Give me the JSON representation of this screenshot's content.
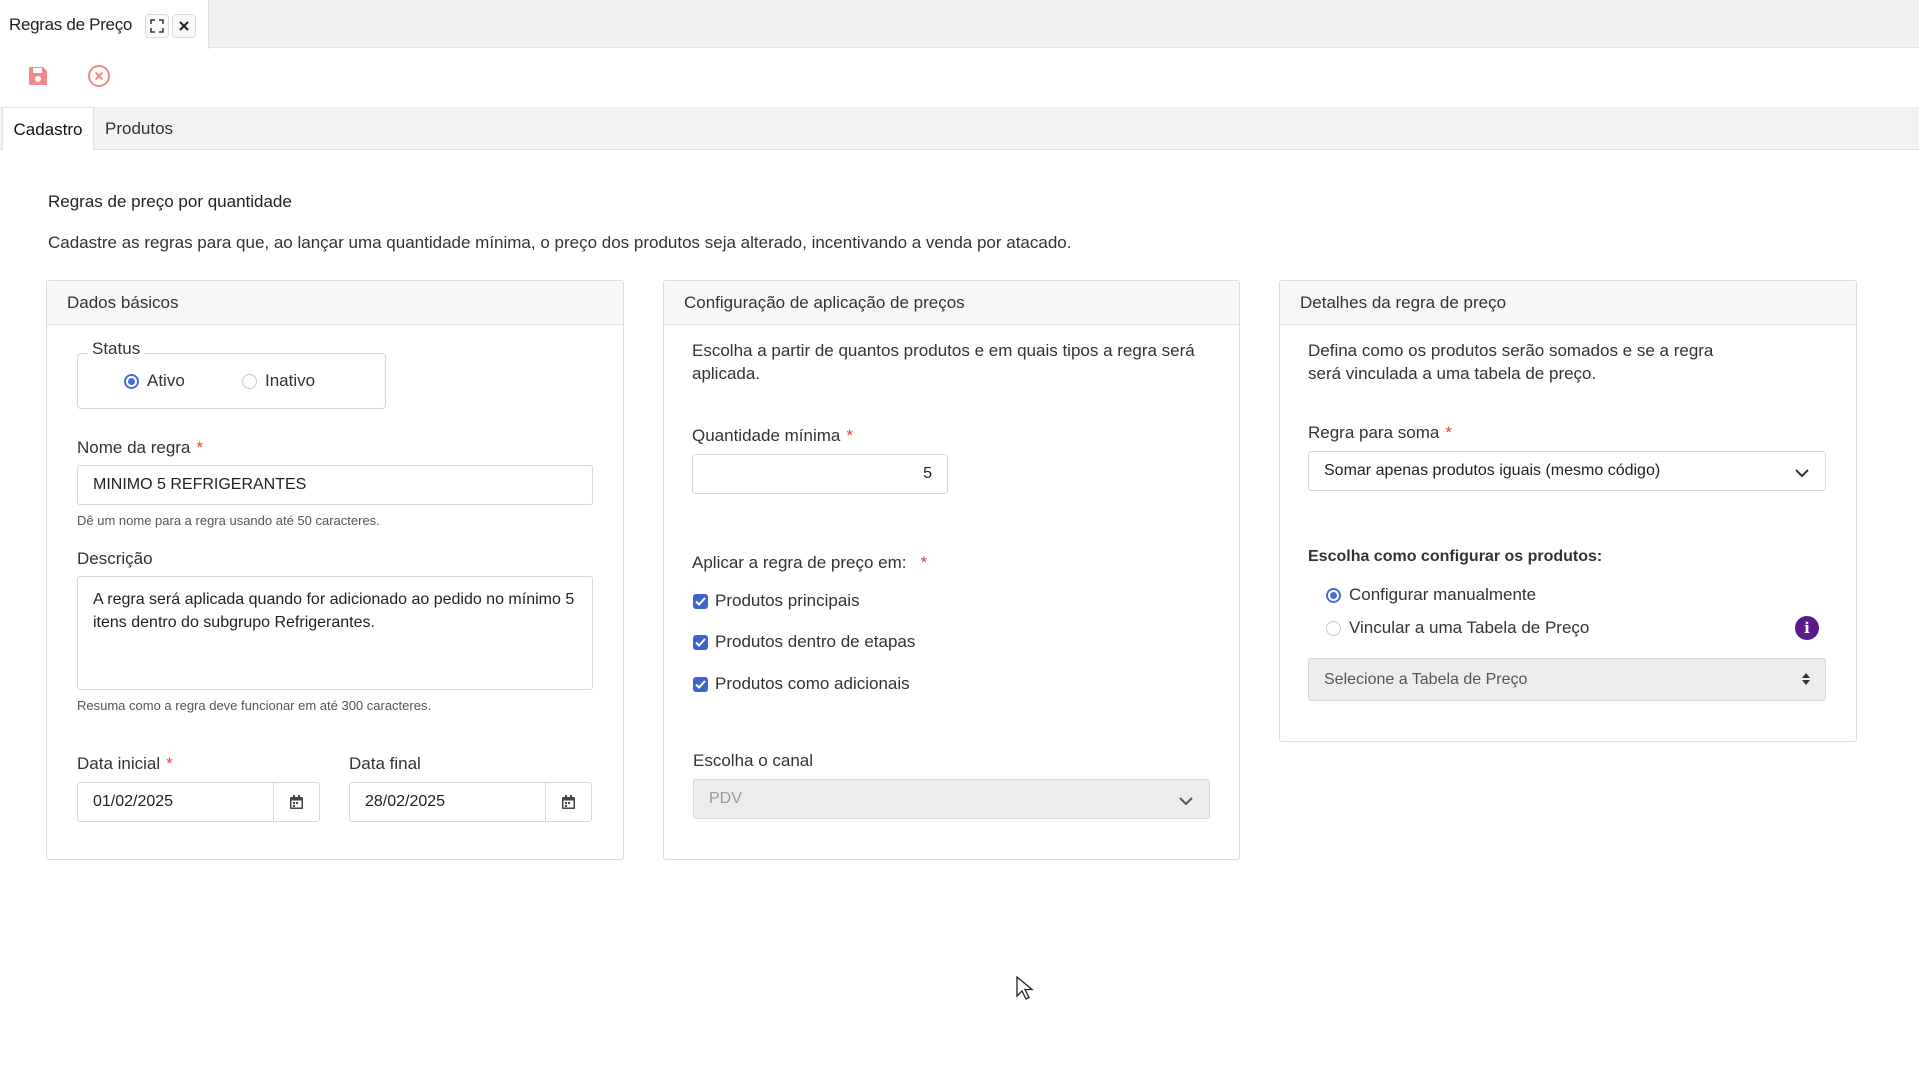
{
  "window_tab": {
    "title": "Regras de Preço"
  },
  "page_tabs": [
    {
      "label": "Cadastro",
      "active": true
    },
    {
      "label": "Produtos",
      "active": false
    }
  ],
  "page": {
    "title": "Regras de preço por quantidade",
    "description": "Cadastre as regras para que, ao lançar uma quantidade mínima, o preço dos produtos seja alterado, incentivando a venda por atacado."
  },
  "basic": {
    "header": "Dados básicos",
    "status_legend": "Status",
    "status_options": [
      "Ativo",
      "Inativo"
    ],
    "status_selected": "Ativo",
    "name_label": "Nome da regra",
    "name_value": "MINIMO 5 REFRIGERANTES",
    "name_hint": "Dê um nome para a regra usando até 50 caracteres.",
    "desc_label": "Descrição",
    "desc_value": "A regra será aplicada quando for adicionado ao pedido no mínimo 5 itens dentro do subgrupo Refrigerantes.",
    "desc_hint": "Resuma como a regra deve funcionar em até 300 caracteres.",
    "start_label": "Data inicial",
    "start_value": "01/02/2025",
    "end_label": "Data final",
    "end_value": "28/02/2025"
  },
  "config": {
    "header": "Configuração de aplicação de preços",
    "intro": "Escolha a partir de quantos produtos e em quais tipos a regra será aplicada.",
    "qty_label": "Quantidade mínima",
    "qty_value": "5",
    "apply_label": "Aplicar a regra de preço em:",
    "apply_options": [
      "Produtos principais",
      "Produtos dentro de etapas",
      "Produtos como adicionais"
    ],
    "channel_label": "Escolha o canal",
    "channel_value": "PDV"
  },
  "details": {
    "header": "Detalhes da regra de preço",
    "intro": "Defina como os produtos serão somados e se a regra será vinculada a uma tabela de preço.",
    "sum_label": "Regra para soma",
    "sum_value": "Somar apenas produtos iguais (mesmo código)",
    "config_label": "Escolha como configurar os produtos:",
    "config_options": [
      "Configurar manualmente",
      "Vincular a uma Tabela de Preço"
    ],
    "config_selected": "Configurar manualmente",
    "table_placeholder": "Selecione a Tabela de Preço"
  },
  "colors": {
    "accent": "#3f63cf",
    "required": "#e04040",
    "info": "#5a1a8c",
    "toolbar_icon": "#f08080"
  }
}
